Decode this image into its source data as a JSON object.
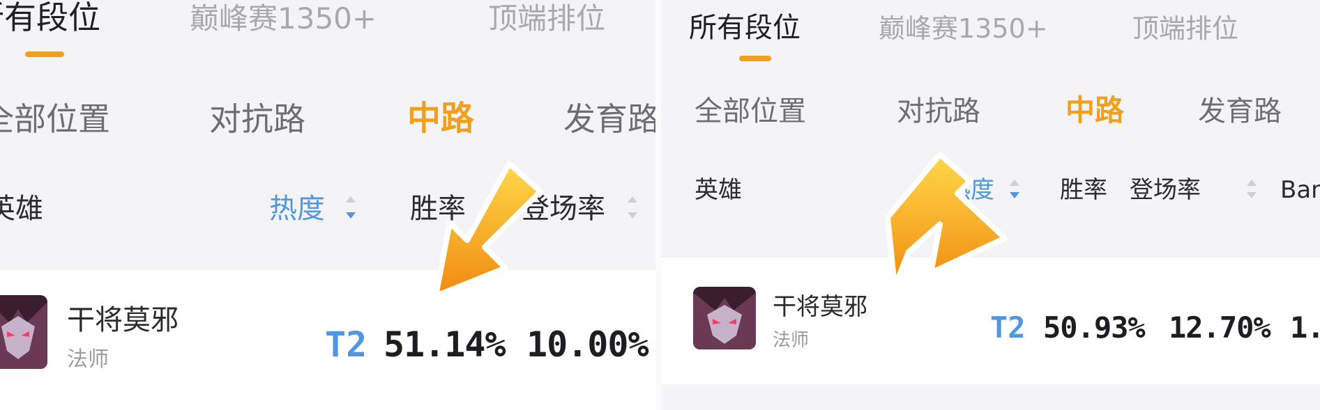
{
  "panels": [
    {
      "rank_tabs": [
        "所有段位",
        "巅峰赛1350+",
        "顶端排位"
      ],
      "position_tabs": [
        "全部位置",
        "对抗路",
        "中路",
        "发育路"
      ],
      "columns": [
        "英雄",
        "热度",
        "胜率",
        "登场率"
      ],
      "row": {
        "hero": "干将莫邪",
        "role": "法师",
        "tier": "T2",
        "win_rate": "51.14%",
        "pick_rate": "10.00%"
      }
    },
    {
      "rank_tabs": [
        "所有段位",
        "巅峰赛1350+",
        "顶端排位"
      ],
      "position_tabs": [
        "全部位置",
        "对抗路",
        "中路",
        "发育路"
      ],
      "columns": [
        "英雄",
        "热度",
        "胜率",
        "登场率",
        "Ban"
      ],
      "row": {
        "hero": "干将莫邪",
        "role": "法师",
        "tier": "T2",
        "win_rate": "50.93%",
        "pick_rate": "12.70%",
        "ban_rate": "1."
      }
    }
  ],
  "icons": {
    "sort": "sort-toggle-icon",
    "arrow": "pointer-arrow-icon",
    "avatar": "hero-avatar-icon"
  },
  "colors": {
    "accent": "#f0a01f",
    "sorted": "#4f98e0",
    "arrow": "#f5a417"
  }
}
